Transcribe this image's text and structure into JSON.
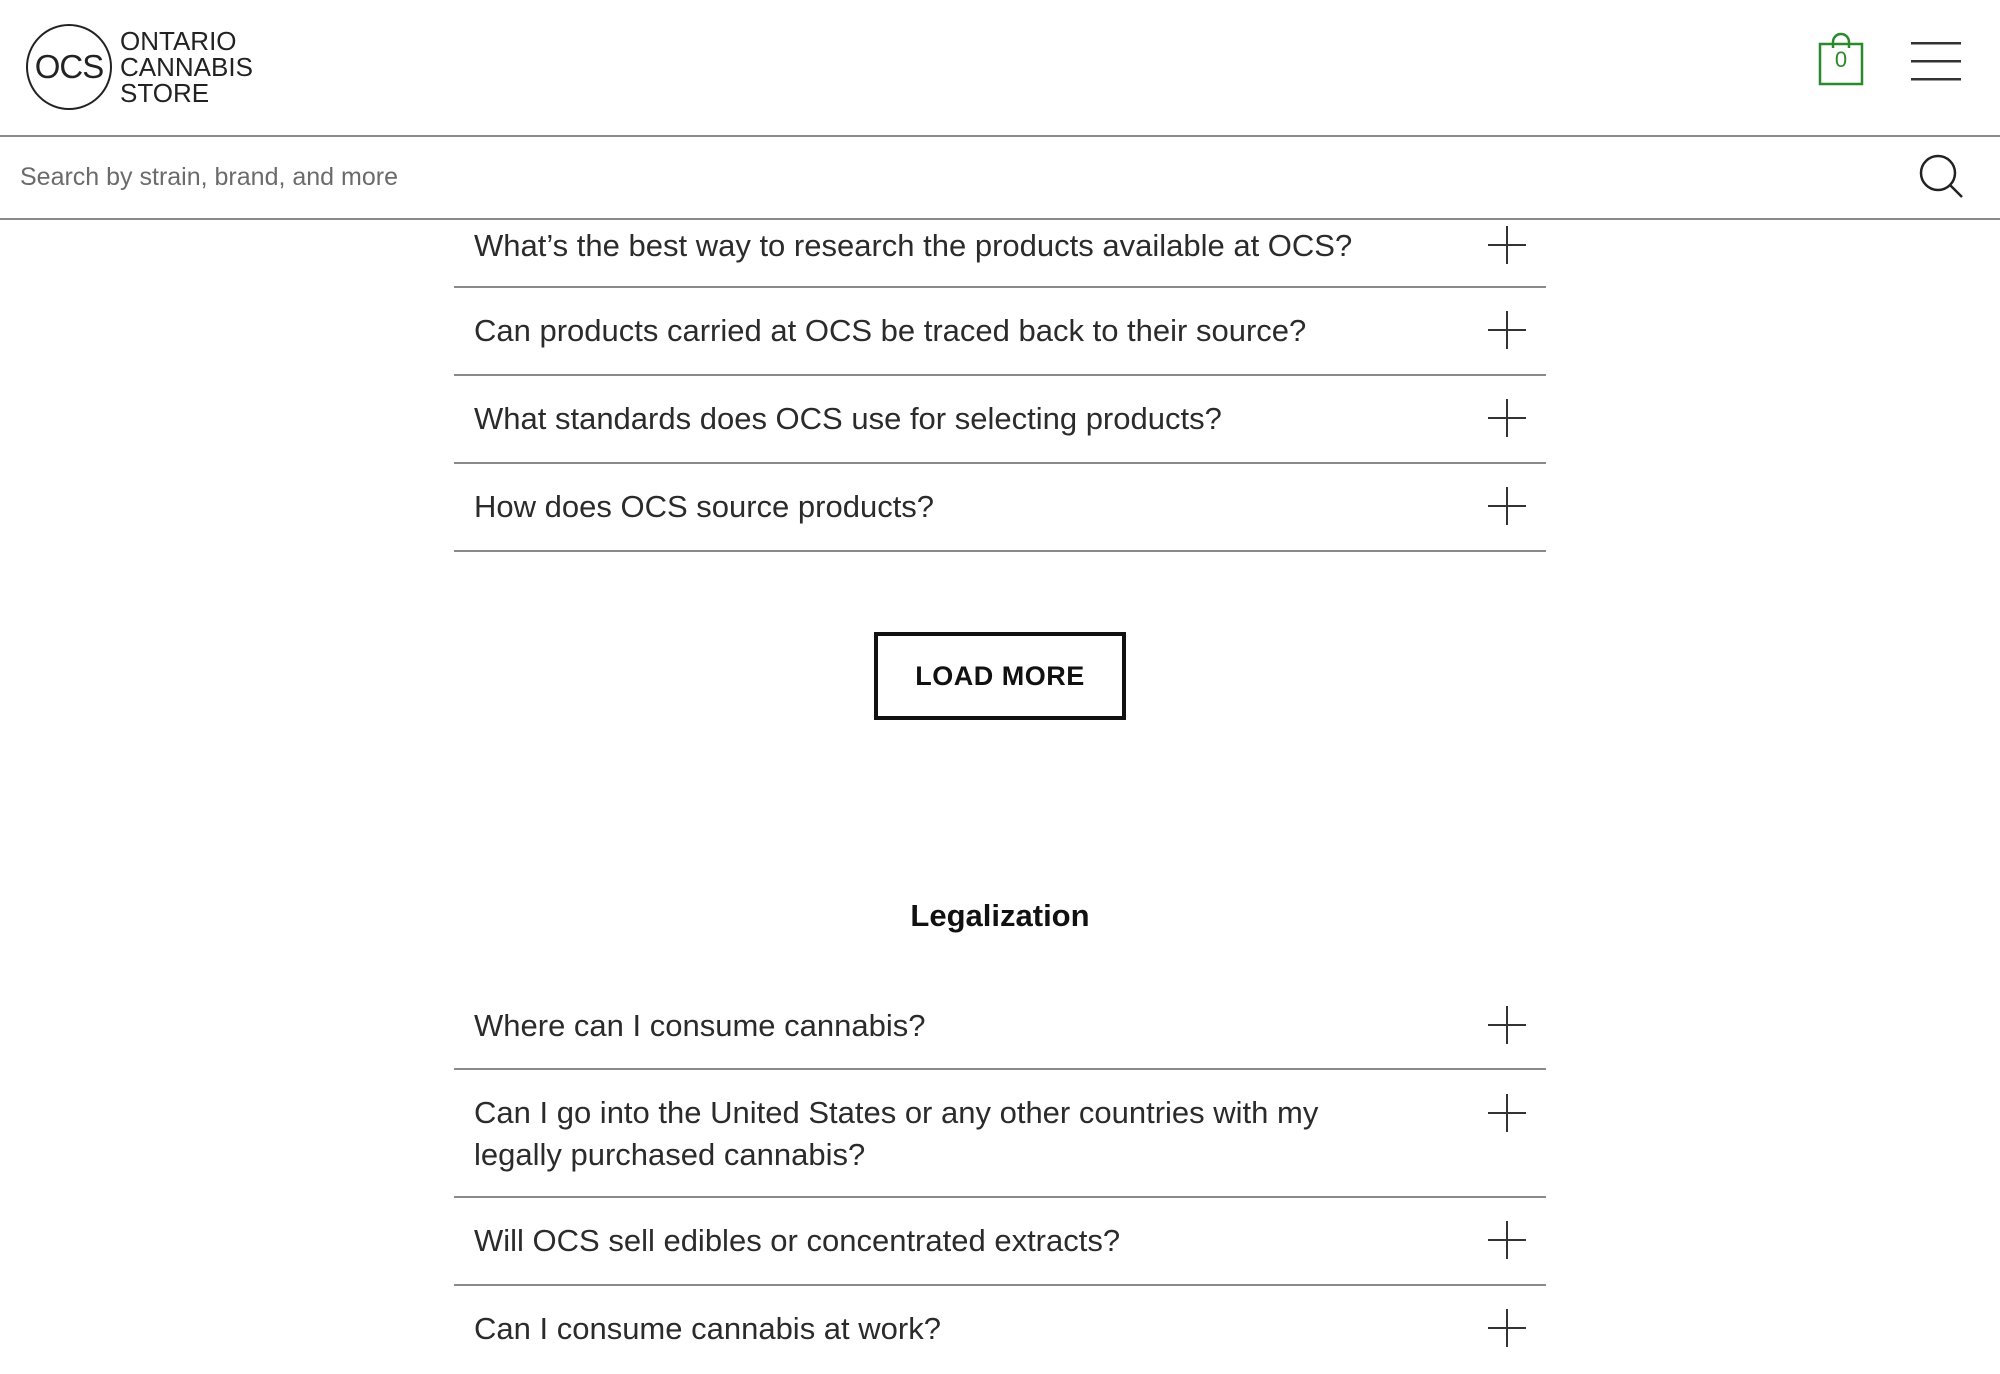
{
  "header": {
    "logo_mark": "OCS",
    "logo_lines": [
      "ONTARIO",
      "CANNABIS",
      "STORE"
    ],
    "cart_count": "0",
    "cart_icon": "shopping-bag-icon",
    "menu_icon": "hamburger-menu-icon"
  },
  "search": {
    "placeholder": "Search by strain, brand, and more",
    "value": "",
    "icon": "search-icon"
  },
  "colors": {
    "cart_accent": "#2a8a2a",
    "divider": "#8a8a8a",
    "text": "#2b2b2b"
  },
  "faq_products": {
    "questions": [
      "What’s the best way to research the products available at OCS?",
      "Can products carried at OCS be traced back to their source?",
      "What standards does OCS use for selecting products?",
      "How does OCS source products?"
    ],
    "load_more_label": "LOAD MORE"
  },
  "faq_legalization": {
    "title": "Legalization",
    "questions": [
      "Where can I consume cannabis?",
      "Can I go into the United States or any other countries with my legally purchased cannabis?",
      "Will OCS sell edibles or concentrated extracts?",
      "Can I consume cannabis at work?"
    ]
  }
}
